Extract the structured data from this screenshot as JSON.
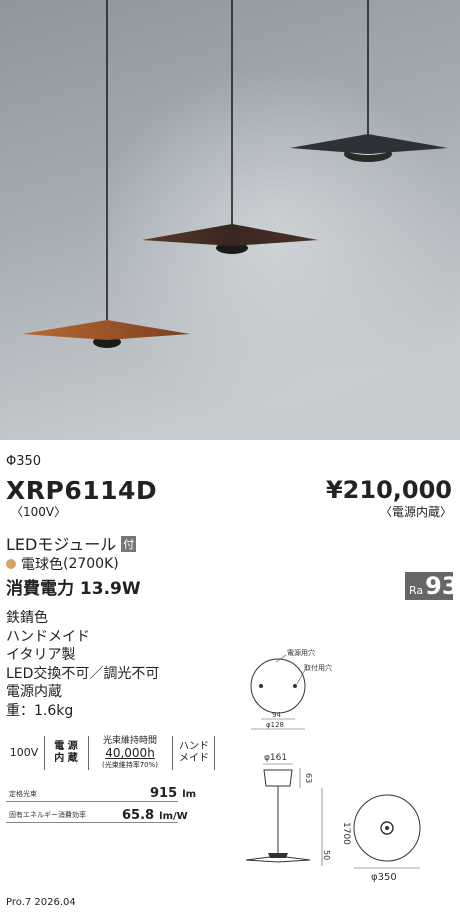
{
  "product": {
    "diameter": "Φ350",
    "model": "XRP6114D",
    "voltage": "〈100V〉",
    "price": "¥210,000",
    "price_note": "〈電源内蔵〉"
  },
  "light": {
    "module_label": "LEDモジュール",
    "module_badge": "付",
    "color_label": "電球色",
    "color_temp": "(2700K)",
    "color_swatch": "#d8a06a",
    "power": "消費電力 13.9W",
    "ra_label": "Ra",
    "ra_value": "93"
  },
  "specs": [
    "鉄錆色",
    "ハンドメイド",
    "イタリア製",
    "LED交換不可／調光不可",
    "電源内蔵",
    "重：1.6kg"
  ],
  "icons": {
    "voltage": "100V",
    "power_source": [
      "電 源",
      "内 蔵"
    ],
    "life_title": "光束維持時間",
    "life_value": "40,000h",
    "life_note": "(光束維持率70%)",
    "handmade": [
      "ハンド",
      "メイド"
    ]
  },
  "performance": {
    "flux_label": "定格光束",
    "flux_value": "915",
    "flux_unit": "lm",
    "efficiency_label": "固有エネルギー消費効率",
    "efficiency_value": "65.8",
    "efficiency_unit": "lm/W"
  },
  "diagram": {
    "top_label1": "電源用穴",
    "top_label2": "取付用穴",
    "top_dim1": "94",
    "top_dim2": "φ128",
    "canopy_dim": "φ161",
    "canopy_height": "63",
    "cord_length": "1700",
    "shade_height": "50",
    "shade_dim": "φ350"
  },
  "footer": "Pro.7 2026.04"
}
